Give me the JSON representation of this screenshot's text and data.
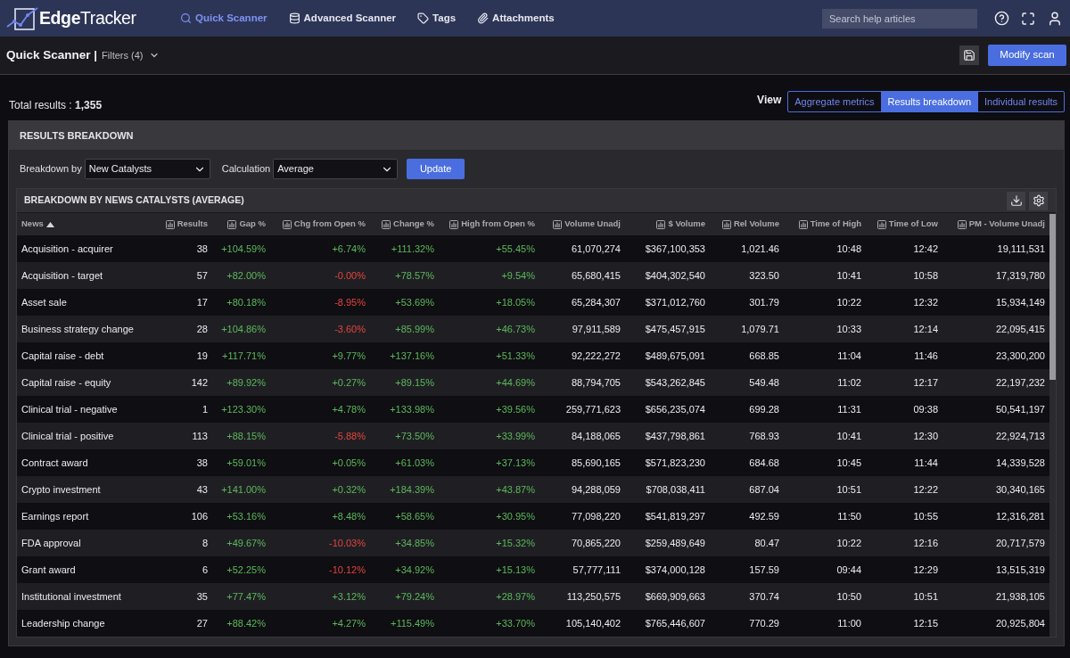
{
  "brand": {
    "name": "**Edge**Tracker"
  },
  "navigation": {
    "items": [
      {
        "label": "Quick Scanner",
        "selected": true
      },
      {
        "label": "Advanced Scanner",
        "selected": false
      },
      {
        "label": "Tags",
        "selected": false
      },
      {
        "label": "Attachments",
        "selected": false
      }
    ]
  },
  "help_search": {
    "placeholder": "Search help articles"
  },
  "page_header": {
    "title": "Quick Scanner |",
    "filters": "Filters (4)",
    "primary_button": "Modify scan"
  },
  "summary": {
    "total": "Total results : **1,355**"
  },
  "view_switch": {
    "label": "View",
    "options": [
      {
        "label": "Aggregate metrics",
        "selected": false
      },
      {
        "label": "Results breakdown",
        "selected": true
      },
      {
        "label": "Individual results",
        "selected": false
      }
    ]
  },
  "results_breakdown": {
    "title": "RESULTS BREAKDOWN",
    "breakdown_by": {
      "label": "Breakdown by",
      "value": "New Catalysts"
    },
    "calculation": {
      "label": "Calculation",
      "value": "Average"
    },
    "update_button": "Update",
    "table": {
      "title": "BREAKDOWN BY NEWS CATALYSTS (AVERAGE)",
      "columns": [
        {
          "label": "News",
          "kind": "label",
          "sorted": true
        },
        {
          "label": "Results",
          "kind": "metric",
          "sorted": false
        },
        {
          "label": "Gap %",
          "kind": "metric",
          "sorted": false
        },
        {
          "label": "Chg from Open %",
          "kind": "metric",
          "sorted": false
        },
        {
          "label": "Change %",
          "kind": "metric",
          "sorted": false
        },
        {
          "label": "High from Open %",
          "kind": "metric",
          "sorted": false
        },
        {
          "label": "Volume Unadj",
          "kind": "metric",
          "sorted": false
        },
        {
          "label": "$ Volume",
          "kind": "metric",
          "sorted": false
        },
        {
          "label": "Rel Volume",
          "kind": "metric",
          "sorted": false
        },
        {
          "label": "Time of High",
          "kind": "metric",
          "sorted": false
        },
        {
          "label": "Time of Low",
          "kind": "metric",
          "sorted": false
        },
        {
          "label": "PM - Volume Unadj",
          "kind": "metric",
          "sorted": false
        }
      ],
      "rows": [
        {
          "cells": [
            "Acquisition - acquirer",
            "38",
            {
              "text": "+104.59%",
              "negative": false
            },
            {
              "text": "+6.74%",
              "negative": false
            },
            {
              "text": "+111.32%",
              "negative": false
            },
            {
              "text": "+55.45%",
              "negative": false
            },
            "61,070,274",
            "$367,100,353",
            "1,021.46",
            "10:48",
            "12:42",
            "19,111,531"
          ]
        },
        {
          "cells": [
            "Acquisition - target",
            "57",
            {
              "text": "+82.00%",
              "negative": false
            },
            {
              "text": "-0.00%",
              "negative": true
            },
            {
              "text": "+78.57%",
              "negative": false
            },
            {
              "text": "+9.54%",
              "negative": false
            },
            "65,680,415",
            "$404,302,540",
            "323.50",
            "10:41",
            "10:58",
            "17,319,780"
          ]
        },
        {
          "cells": [
            "Asset sale",
            "17",
            {
              "text": "+80.18%",
              "negative": false
            },
            {
              "text": "-8.95%",
              "negative": true
            },
            {
              "text": "+53.69%",
              "negative": false
            },
            {
              "text": "+18.05%",
              "negative": false
            },
            "65,284,307",
            "$371,012,760",
            "301.79",
            "10:22",
            "12:32",
            "15,934,149"
          ]
        },
        {
          "cells": [
            "Business strategy change",
            "28",
            {
              "text": "+104.86%",
              "negative": false
            },
            {
              "text": "-3.60%",
              "negative": true
            },
            {
              "text": "+85.99%",
              "negative": false
            },
            {
              "text": "+46.73%",
              "negative": false
            },
            "97,911,589",
            "$475,457,915",
            "1,079.71",
            "10:33",
            "12:14",
            "22,095,415"
          ]
        },
        {
          "cells": [
            "Capital raise - debt",
            "19",
            {
              "text": "+117.71%",
              "negative": false
            },
            {
              "text": "+9.77%",
              "negative": false
            },
            {
              "text": "+137.16%",
              "negative": false
            },
            {
              "text": "+51.33%",
              "negative": false
            },
            "92,222,272",
            "$489,675,091",
            "668.85",
            "11:04",
            "11:46",
            "23,300,200"
          ]
        },
        {
          "cells": [
            "Capital raise - equity",
            "142",
            {
              "text": "+89.92%",
              "negative": false
            },
            {
              "text": "+0.27%",
              "negative": false
            },
            {
              "text": "+89.15%",
              "negative": false
            },
            {
              "text": "+44.69%",
              "negative": false
            },
            "88,794,705",
            "$543,262,845",
            "549.48",
            "11:02",
            "12:17",
            "22,197,232"
          ]
        },
        {
          "cells": [
            "Clinical trial - negative",
            "1",
            {
              "text": "+123.30%",
              "negative": false
            },
            {
              "text": "+4.78%",
              "negative": false
            },
            {
              "text": "+133.98%",
              "negative": false
            },
            {
              "text": "+39.56%",
              "negative": false
            },
            "259,771,623",
            "$656,235,074",
            "699.28",
            "11:31",
            "09:38",
            "50,541,197"
          ]
        },
        {
          "cells": [
            "Clinical trial - positive",
            "113",
            {
              "text": "+88.15%",
              "negative": false
            },
            {
              "text": "-5.88%",
              "negative": true
            },
            {
              "text": "+73.50%",
              "negative": false
            },
            {
              "text": "+33.99%",
              "negative": false
            },
            "84,188,065",
            "$437,798,861",
            "768.93",
            "10:41",
            "12:30",
            "22,924,713"
          ]
        },
        {
          "cells": [
            "Contract award",
            "38",
            {
              "text": "+59.01%",
              "negative": false
            },
            {
              "text": "+0.05%",
              "negative": false
            },
            {
              "text": "+61.03%",
              "negative": false
            },
            {
              "text": "+37.13%",
              "negative": false
            },
            "85,690,165",
            "$571,823,230",
            "684.68",
            "10:45",
            "11:44",
            "14,339,528"
          ]
        },
        {
          "cells": [
            "Crypto investment",
            "43",
            {
              "text": "+141.00%",
              "negative": false
            },
            {
              "text": "+0.32%",
              "negative": false
            },
            {
              "text": "+184.39%",
              "negative": false
            },
            {
              "text": "+43.87%",
              "negative": false
            },
            "94,288,059",
            "$708,038,411",
            "687.04",
            "10:51",
            "12:22",
            "30,340,165"
          ]
        },
        {
          "cells": [
            "Earnings report",
            "106",
            {
              "text": "+53.16%",
              "negative": false
            },
            {
              "text": "+8.48%",
              "negative": false
            },
            {
              "text": "+58.65%",
              "negative": false
            },
            {
              "text": "+30.95%",
              "negative": false
            },
            "77,098,220",
            "$541,819,297",
            "492.59",
            "11:50",
            "10:55",
            "12,316,281"
          ]
        },
        {
          "cells": [
            "FDA approval",
            "8",
            {
              "text": "+49.67%",
              "negative": false
            },
            {
              "text": "-10.03%",
              "negative": true
            },
            {
              "text": "+34.85%",
              "negative": false
            },
            {
              "text": "+15.32%",
              "negative": false
            },
            "70,865,220",
            "$259,489,649",
            "80.47",
            "10:22",
            "12:16",
            "20,717,579"
          ]
        },
        {
          "cells": [
            "Grant award",
            "6",
            {
              "text": "+52.25%",
              "negative": false
            },
            {
              "text": "-10.12%",
              "negative": true
            },
            {
              "text": "+34.92%",
              "negative": false
            },
            {
              "text": "+15.13%",
              "negative": false
            },
            "57,777,111",
            "$374,000,128",
            "157.59",
            "09:44",
            "12:29",
            "13,515,319"
          ]
        },
        {
          "cells": [
            "Institutional investment",
            "35",
            {
              "text": "+77.47%",
              "negative": false
            },
            {
              "text": "+3.12%",
              "negative": false
            },
            {
              "text": "+79.24%",
              "negative": false
            },
            {
              "text": "+28.97%",
              "negative": false
            },
            "113,250,575",
            "$669,909,663",
            "370.74",
            "10:50",
            "10:51",
            "21,938,105"
          ]
        },
        {
          "cells": [
            "Leadership change",
            "27",
            {
              "text": "+88.42%",
              "negative": false
            },
            {
              "text": "+4.27%",
              "negative": false
            },
            {
              "text": "+115.49%",
              "negative": false
            },
            {
              "text": "+33.70%",
              "negative": false
            },
            "105,140,402",
            "$765,446,607",
            "770.29",
            "11:00",
            "12:15",
            "20,925,804"
          ]
        }
      ]
    }
  }
}
